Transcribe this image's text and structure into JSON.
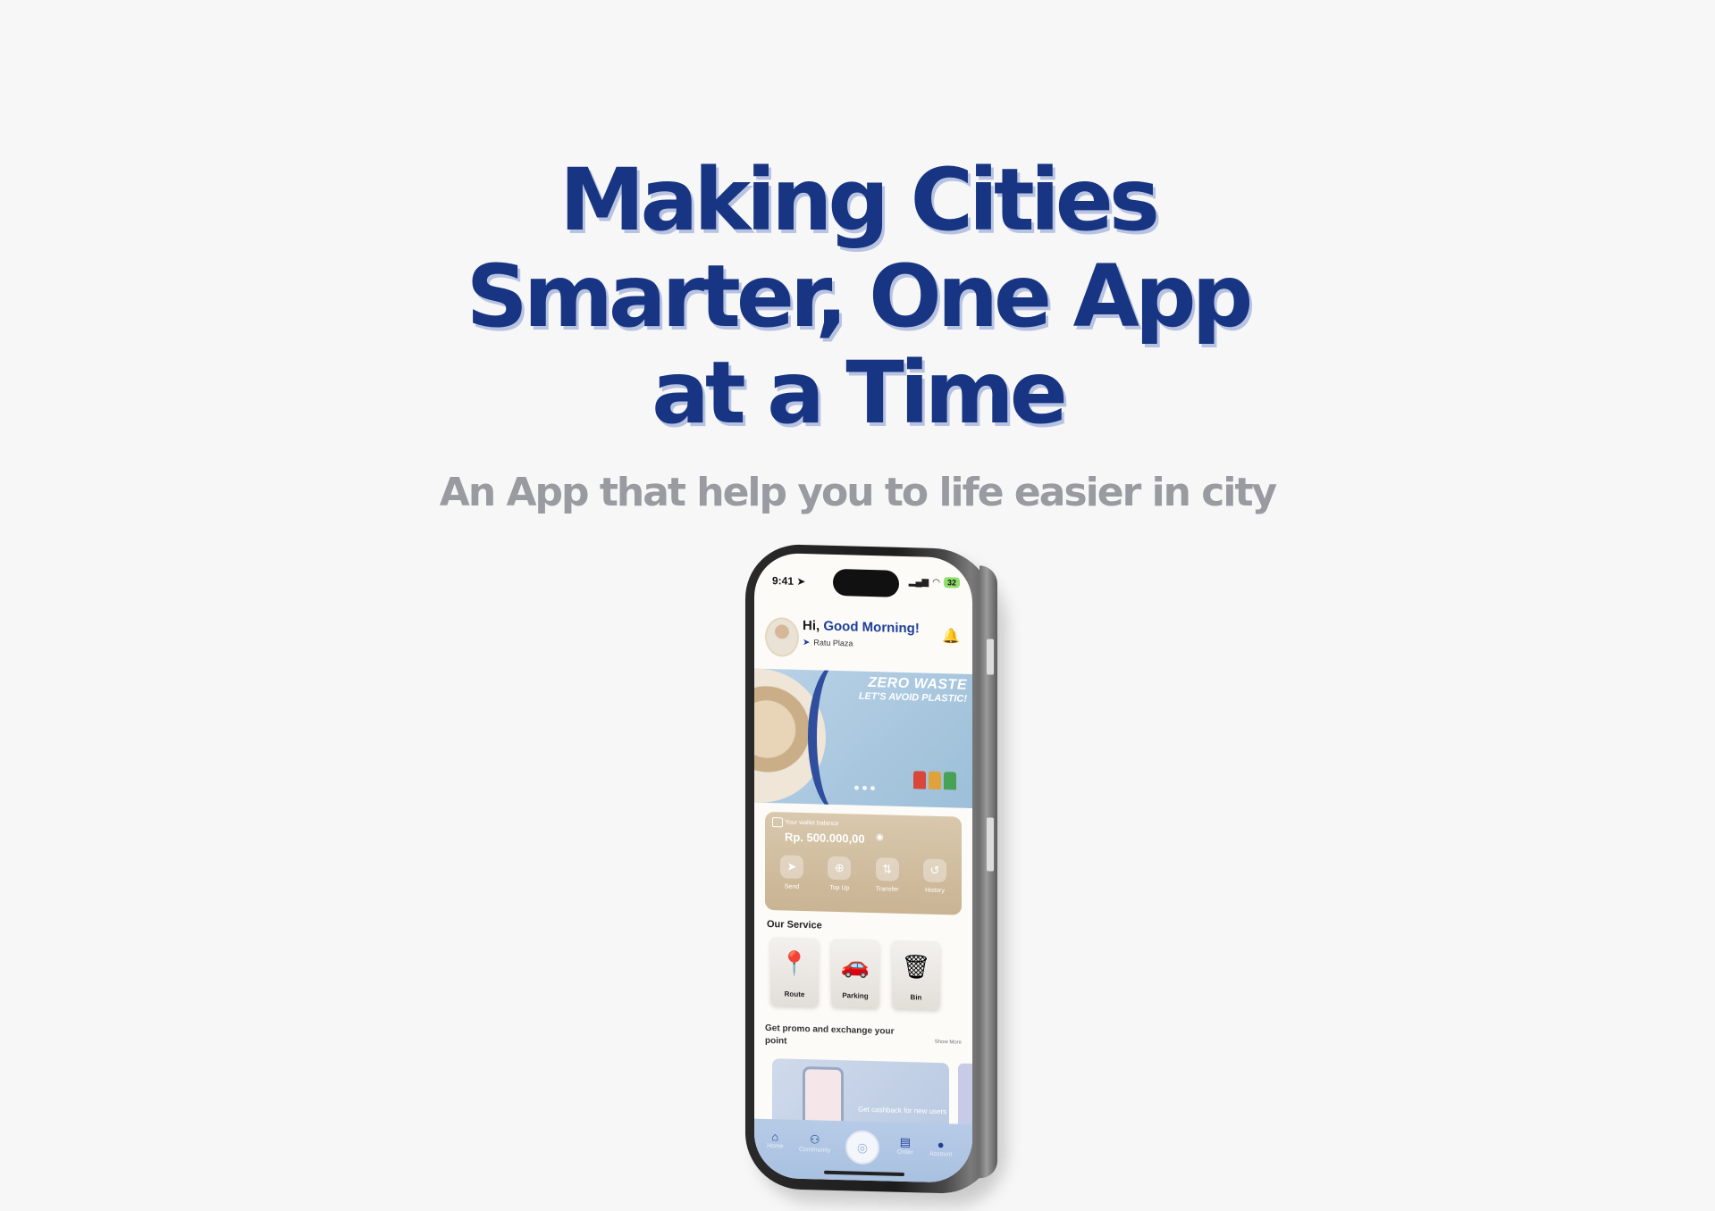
{
  "hero": {
    "title_lines": [
      "Making Cities",
      "Smarter, One App",
      "at a Time"
    ],
    "subtitle": "An App that help you to life easier in city"
  },
  "phone": {
    "status": {
      "time": "9:41",
      "battery": "32"
    },
    "greeting": {
      "hi": "Hi,",
      "morning": "Good Morning!",
      "location": "Ratu Plaza"
    },
    "banner": {
      "title": "ZERO WASTE",
      "subtitle": "LET'S AVOID PLASTIC!"
    },
    "wallet": {
      "label": "Your wallet balance",
      "amount": "Rp. 500.000,00",
      "actions": [
        {
          "label": "Send",
          "icon": "send-icon"
        },
        {
          "label": "Top Up",
          "icon": "plus-circle-icon"
        },
        {
          "label": "Transfer",
          "icon": "transfer-icon"
        },
        {
          "label": "History",
          "icon": "history-icon"
        }
      ]
    },
    "services": {
      "title": "Our Service",
      "items": [
        {
          "label": "Route",
          "icon": "map-pin-icon"
        },
        {
          "label": "Parking",
          "icon": "parking-icon"
        },
        {
          "label": "Bin",
          "icon": "bin-icon"
        }
      ]
    },
    "promo": {
      "title": "Get promo and exchange your point",
      "show_more": "Show More",
      "card_text": "Get cashback for new users"
    },
    "nav": [
      "Home",
      "Community",
      "Order",
      "Account"
    ]
  },
  "colors": {
    "brand_blue": "#173582",
    "subtitle_gray": "#9a9aa1",
    "wallet_tan": "#d9c8ad"
  }
}
